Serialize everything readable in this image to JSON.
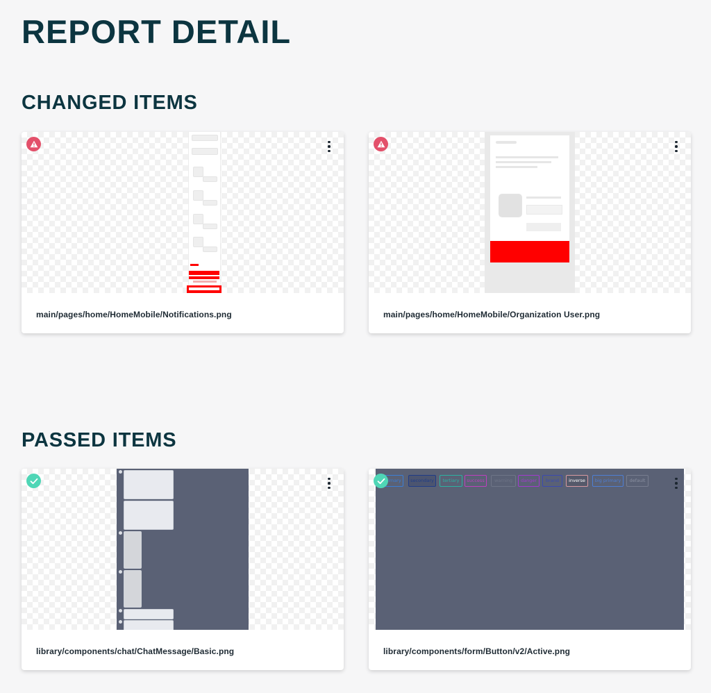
{
  "page": {
    "title": "REPORT DETAIL"
  },
  "sections": {
    "changed": {
      "title": "CHANGED ITEMS"
    },
    "passed": {
      "title": "PASSED ITEMS"
    }
  },
  "changed_items": [
    {
      "caption": "main/pages/home/HomeMobile/Notifications.png",
      "status": "changed",
      "badge_icon": "warning-icon"
    },
    {
      "caption": "main/pages/home/HomeMobile/Organization User.png",
      "status": "changed",
      "badge_icon": "warning-icon"
    }
  ],
  "passed_items": [
    {
      "caption": "library/components/chat/ChatMessage/Basic.png",
      "status": "passed",
      "badge_icon": "check-icon"
    },
    {
      "caption": "library/components/form/Button/v2/Active.png",
      "status": "passed",
      "badge_icon": "check-icon"
    }
  ],
  "button_preview_labels": [
    "primary",
    "secondary",
    "tertiary",
    "success",
    "warning",
    "danger",
    "brand",
    "inverse",
    "big primary",
    "default"
  ],
  "colors": {
    "title": "#0c3540",
    "warning_badge": "#e3506a",
    "passed_badge": "#4fd6b6",
    "diff_red": "#ff0000",
    "dark_preview": "#5a6175"
  },
  "icons": {
    "menu": "more-vertical-icon",
    "warning": "warning-icon",
    "passed": "check-icon"
  }
}
